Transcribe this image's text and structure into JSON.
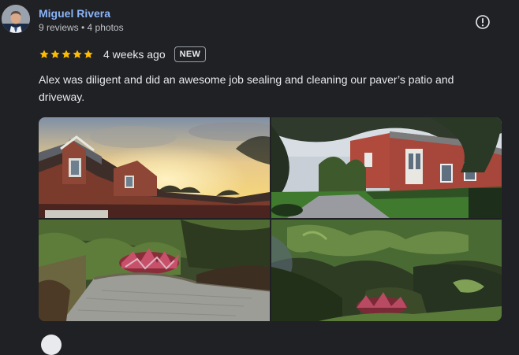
{
  "review": {
    "author_name": "Miguel Rivera",
    "author_meta": "9 reviews • 4 photos",
    "rating": 5,
    "time_ago": "4 weeks ago",
    "badge": "NEW",
    "text": "Alex was diligent and did an awesome job sealing and cleaning our paver’s patio and driveway."
  },
  "icons": {
    "avatar": "person-photo",
    "more": "exclamation-circle-icon",
    "star": "star-icon"
  },
  "colors": {
    "background": "#202124",
    "author_link": "#8ab4f8",
    "star": "#fbbc04",
    "text": "#e8eaed"
  }
}
